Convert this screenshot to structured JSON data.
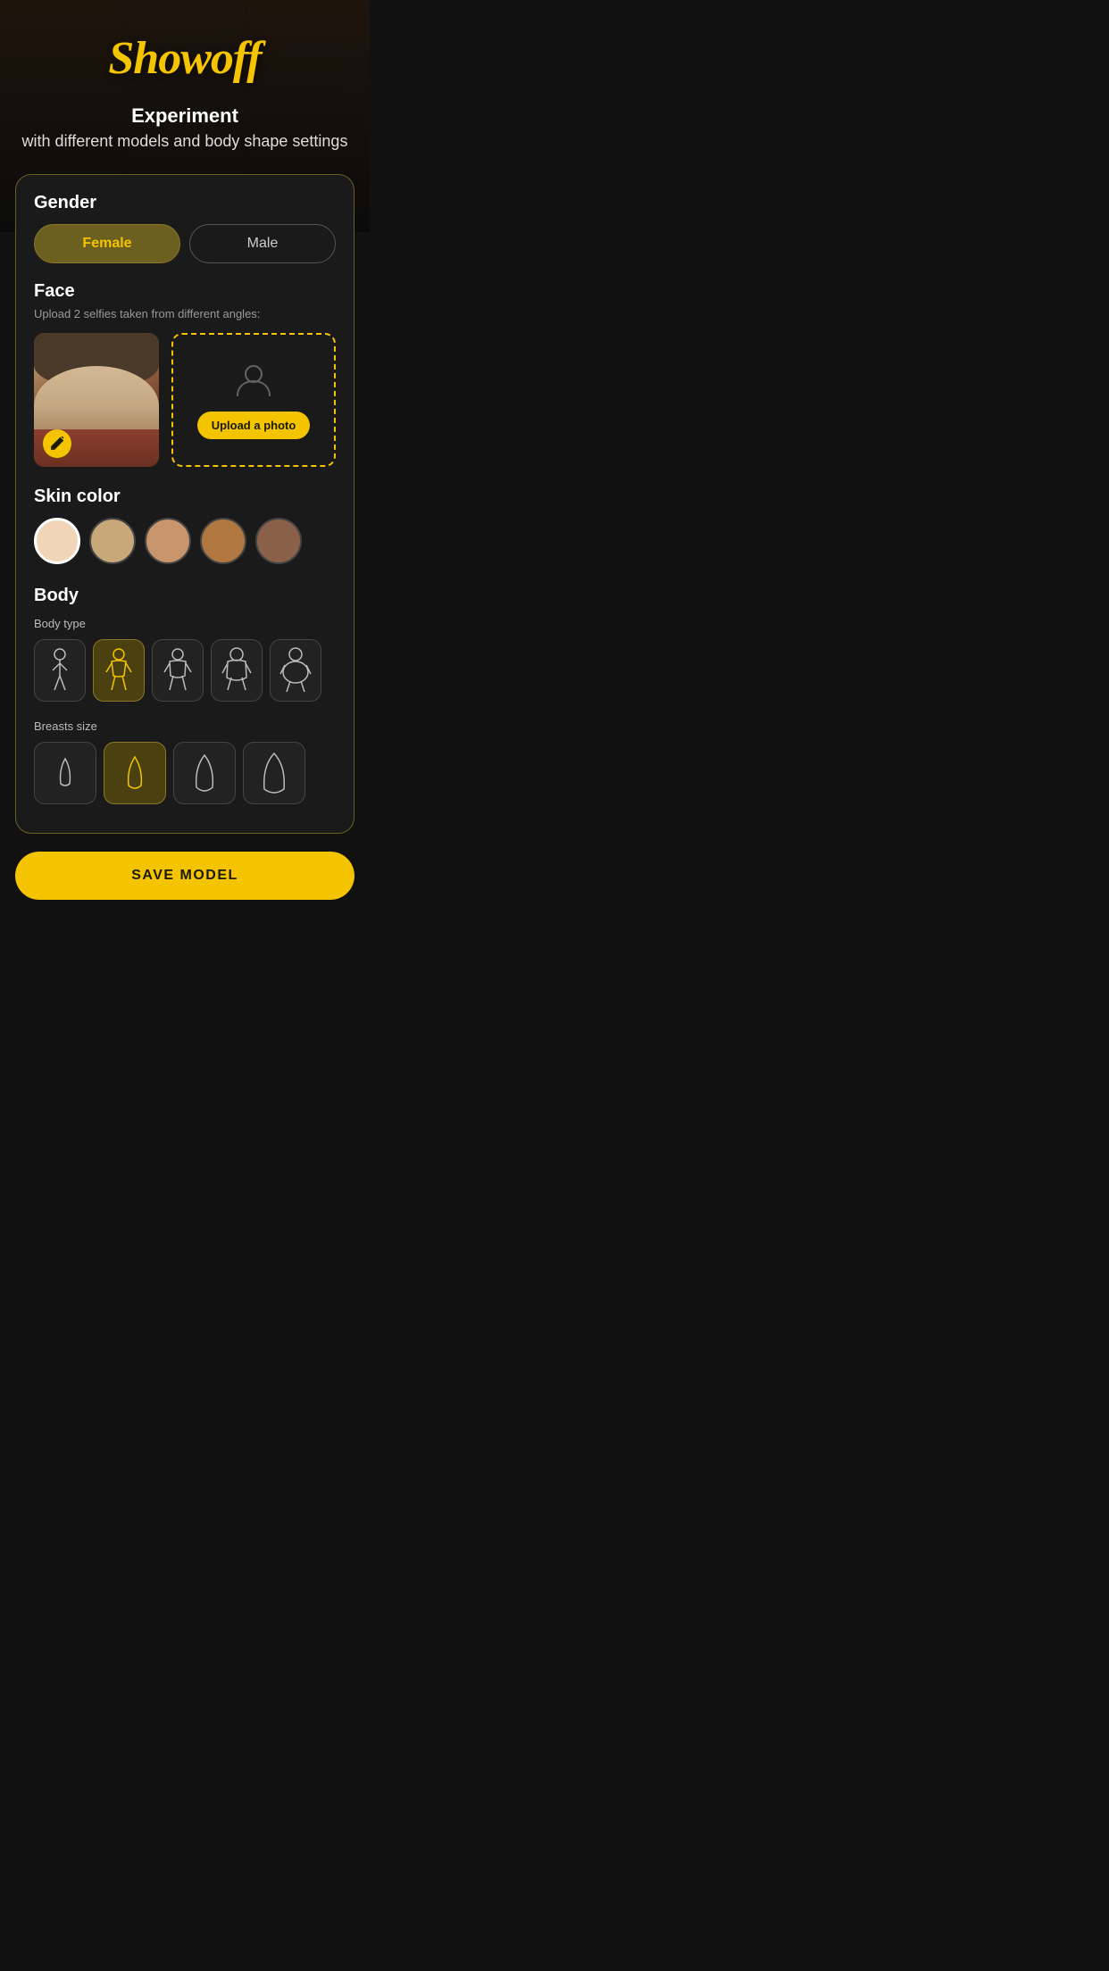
{
  "app": {
    "title": "Showoff"
  },
  "tagline": {
    "main": "Experiment",
    "sub": "with different models and body shape settings"
  },
  "gender": {
    "label": "Gender",
    "options": [
      "Female",
      "Male"
    ],
    "selected": "Female"
  },
  "face": {
    "label": "Face",
    "subtitle": "Upload 2 selfies taken from different angles:",
    "upload_btn_label": "Upload a photo"
  },
  "skin_color": {
    "label": "Skin color",
    "swatches": [
      "#f2d5b8",
      "#c8a878",
      "#c8956c",
      "#b07840",
      "#8a6048"
    ]
  },
  "body": {
    "label": "Body",
    "body_type": {
      "label": "Body type",
      "options": [
        "slim",
        "athletic",
        "average",
        "chubby",
        "heavy"
      ],
      "selected": 1
    },
    "breast_size": {
      "label": "Breasts size",
      "options": [
        "small",
        "medium",
        "large",
        "xlarge"
      ],
      "selected": 1
    }
  },
  "save_btn": "SAVE MODEL"
}
